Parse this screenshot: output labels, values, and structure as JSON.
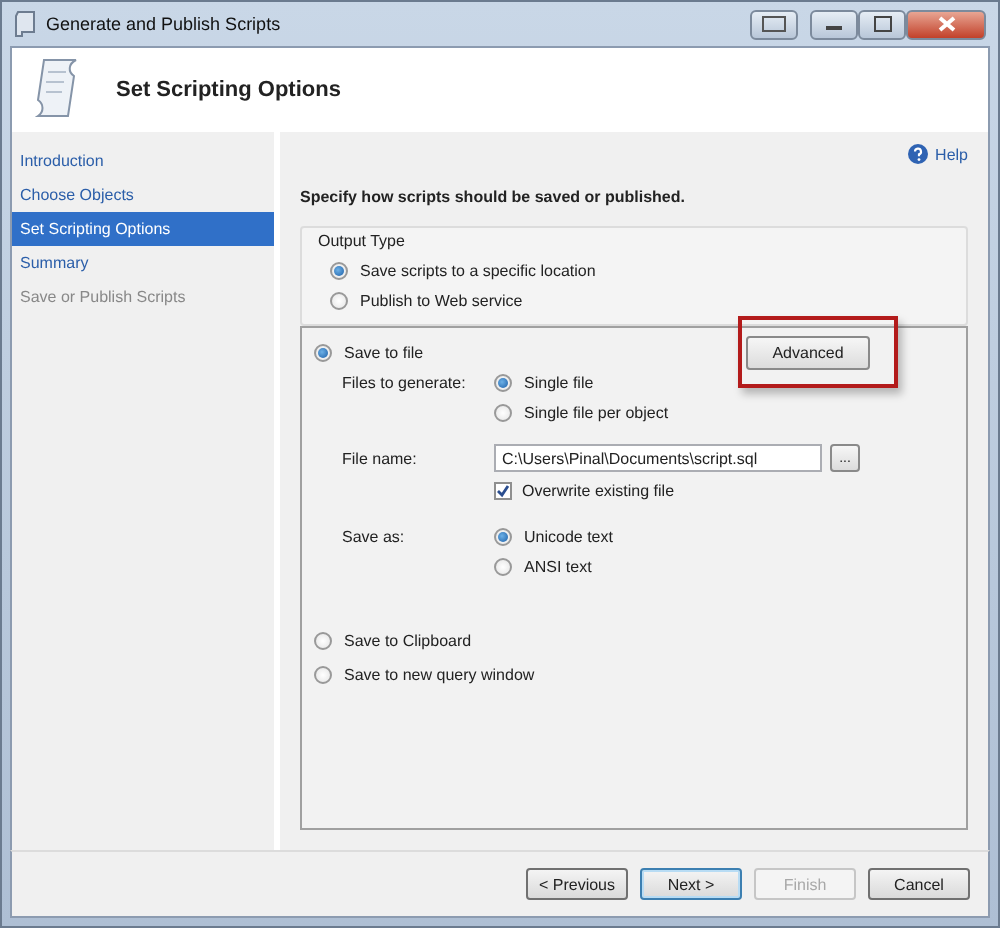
{
  "window": {
    "title": "Generate and Publish Scripts"
  },
  "header": {
    "title": "Set Scripting Options"
  },
  "sidebar": {
    "items": [
      {
        "label": "Introduction",
        "selected": false,
        "disabled": false
      },
      {
        "label": "Choose Objects",
        "selected": false,
        "disabled": false
      },
      {
        "label": "Set Scripting Options",
        "selected": true,
        "disabled": false
      },
      {
        "label": "Summary",
        "selected": false,
        "disabled": false
      },
      {
        "label": "Save or Publish Scripts",
        "selected": false,
        "disabled": true
      }
    ]
  },
  "help": {
    "label": "Help"
  },
  "instruction": "Specify how scripts should be saved or published.",
  "output_type": {
    "title": "Output Type",
    "options": [
      {
        "label": "Save scripts to a specific location",
        "selected": true
      },
      {
        "label": "Publish to Web service",
        "selected": false
      }
    ]
  },
  "destination": {
    "save_to_file": {
      "label": "Save to file",
      "selected": true
    },
    "advanced_button": {
      "label": "Advanced",
      "highlighted": true
    },
    "files_to_generate": {
      "label": "Files to generate:",
      "options": [
        {
          "label": "Single file",
          "selected": true
        },
        {
          "label": "Single file per object",
          "selected": false
        }
      ]
    },
    "file_name": {
      "label": "File name:",
      "value": "C:\\Users\\Pinal\\Documents\\script.sql",
      "browse": "..."
    },
    "overwrite": {
      "label": "Overwrite existing file",
      "checked": true
    },
    "save_as": {
      "label": "Save as:",
      "options": [
        {
          "label": "Unicode text",
          "selected": true
        },
        {
          "label": "ANSI text",
          "selected": false
        }
      ]
    },
    "others": [
      {
        "label": "Save to Clipboard",
        "selected": false
      },
      {
        "label": "Save to new query window",
        "selected": false
      }
    ]
  },
  "buttons": [
    {
      "label": "< Previous",
      "disabled": false,
      "default": false
    },
    {
      "label": "Next >",
      "disabled": false,
      "default": true
    },
    {
      "label": "Finish",
      "disabled": true,
      "default": false
    },
    {
      "label": "Cancel",
      "disabled": false,
      "default": false
    }
  ]
}
